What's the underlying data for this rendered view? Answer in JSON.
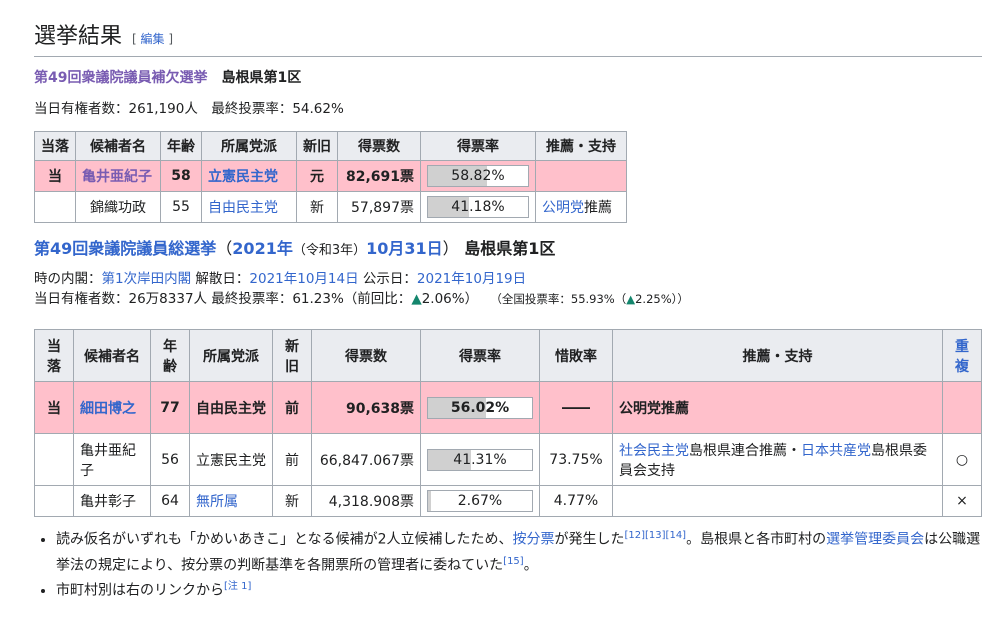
{
  "section": {
    "title": "選挙結果",
    "edit_bracket_open": "[",
    "edit_label": "編集",
    "edit_bracket_close": "]"
  },
  "by_election": {
    "title": "第49回衆議院議員補欠選挙",
    "district": "島根県第1区",
    "stats": "当日有権者数：261,190人　最終投票率：54.62%",
    "headers": [
      "当落",
      "候補者名",
      "年齢",
      "所属党派",
      "新旧",
      "得票数",
      "得票率",
      "推薦・支持"
    ],
    "rows": [
      {
        "result": "当",
        "name": "亀井亜紀子",
        "age": "58",
        "party": "立憲民主党",
        "status": "元",
        "votes": "82,691票",
        "rate": 58.82,
        "rate_label": "58.82%",
        "support_link": "",
        "support_text": ""
      },
      {
        "result": "",
        "name": "錦織功政",
        "age": "55",
        "party": "自由民主党",
        "status": "新",
        "votes": "57,897票",
        "rate": 41.18,
        "rate_label": "41.18%",
        "support_link": "公明党",
        "support_text": "推薦"
      }
    ]
  },
  "general": {
    "title": "第49回衆議院議員総選挙",
    "paren_open": "（",
    "year": "2021年",
    "era": "（令和3年）",
    "date": "10月31日",
    "paren_close": "）",
    "district": "島根県第1区",
    "cabinet_label": "時の内閣：",
    "cabinet": "第1次岸田内閣",
    "dissolution_label": " 解散日：",
    "dissolution": "2021年10月14日",
    "announce_label": " 公示日：",
    "announce": "2021年10月19日",
    "stats": "当日有権者数：26万8337人 最終投票率：61.23%（前回比：",
    "change_arrow": "▲",
    "change": "2.06%",
    "stats_close": "）",
    "national_open": "（全国投票率：55.93%（",
    "national_arrow": "▲",
    "national_change": "2.25%",
    "national_close": "））",
    "headers": [
      "当落",
      "候補者名",
      "年齢",
      "所属党派",
      "新旧",
      "得票数",
      "得票率",
      "惜敗率",
      "推薦・支持",
      "重複"
    ],
    "rows": [
      {
        "result": "当",
        "name": "細田博之",
        "age": "77",
        "party": "自由民主党",
        "status": "前",
        "votes": "90,638票",
        "rate": 56.02,
        "rate_label": "56.02%",
        "loss_rate": "――",
        "support": "公明党推薦",
        "dup": ""
      },
      {
        "result": "",
        "name": "亀井亜紀子",
        "age": "56",
        "party": "立憲民主党",
        "status": "前",
        "votes": "66,847.067票",
        "rate": 41.31,
        "rate_label": "41.31%",
        "loss_rate": "73.75%",
        "support_link1": "社会民主党",
        "support_mid": "島根県連合推薦・",
        "support_link2": "日本共産党",
        "support_end": "島根県委員会支持",
        "dup": "○"
      },
      {
        "result": "",
        "name": "亀井彰子",
        "age": "64",
        "party": "無所属",
        "status": "新",
        "votes": "4,318.908票",
        "rate": 2.67,
        "rate_label": "2.67%",
        "loss_rate": "4.77%",
        "support": "",
        "dup": "×"
      }
    ]
  },
  "notes": {
    "n1_a": "読み仮名がいずれも「かめいあきこ」となる候補が2人立候補したため、",
    "n1_link": "按分票",
    "n1_b": "が発生した",
    "n1_refs": "[12][13][14]",
    "n1_c": "。島根県と各市町村の",
    "n1_link2": "選挙管理委員会",
    "n1_d": "は公職選挙法の規定により、按分票の判断基準を各開票所の管理者に委ねていた",
    "n1_ref2": "[15]",
    "n1_e": "。",
    "n2": "市町村別は右のリンクから",
    "n2_ref": "[注 1]"
  }
}
